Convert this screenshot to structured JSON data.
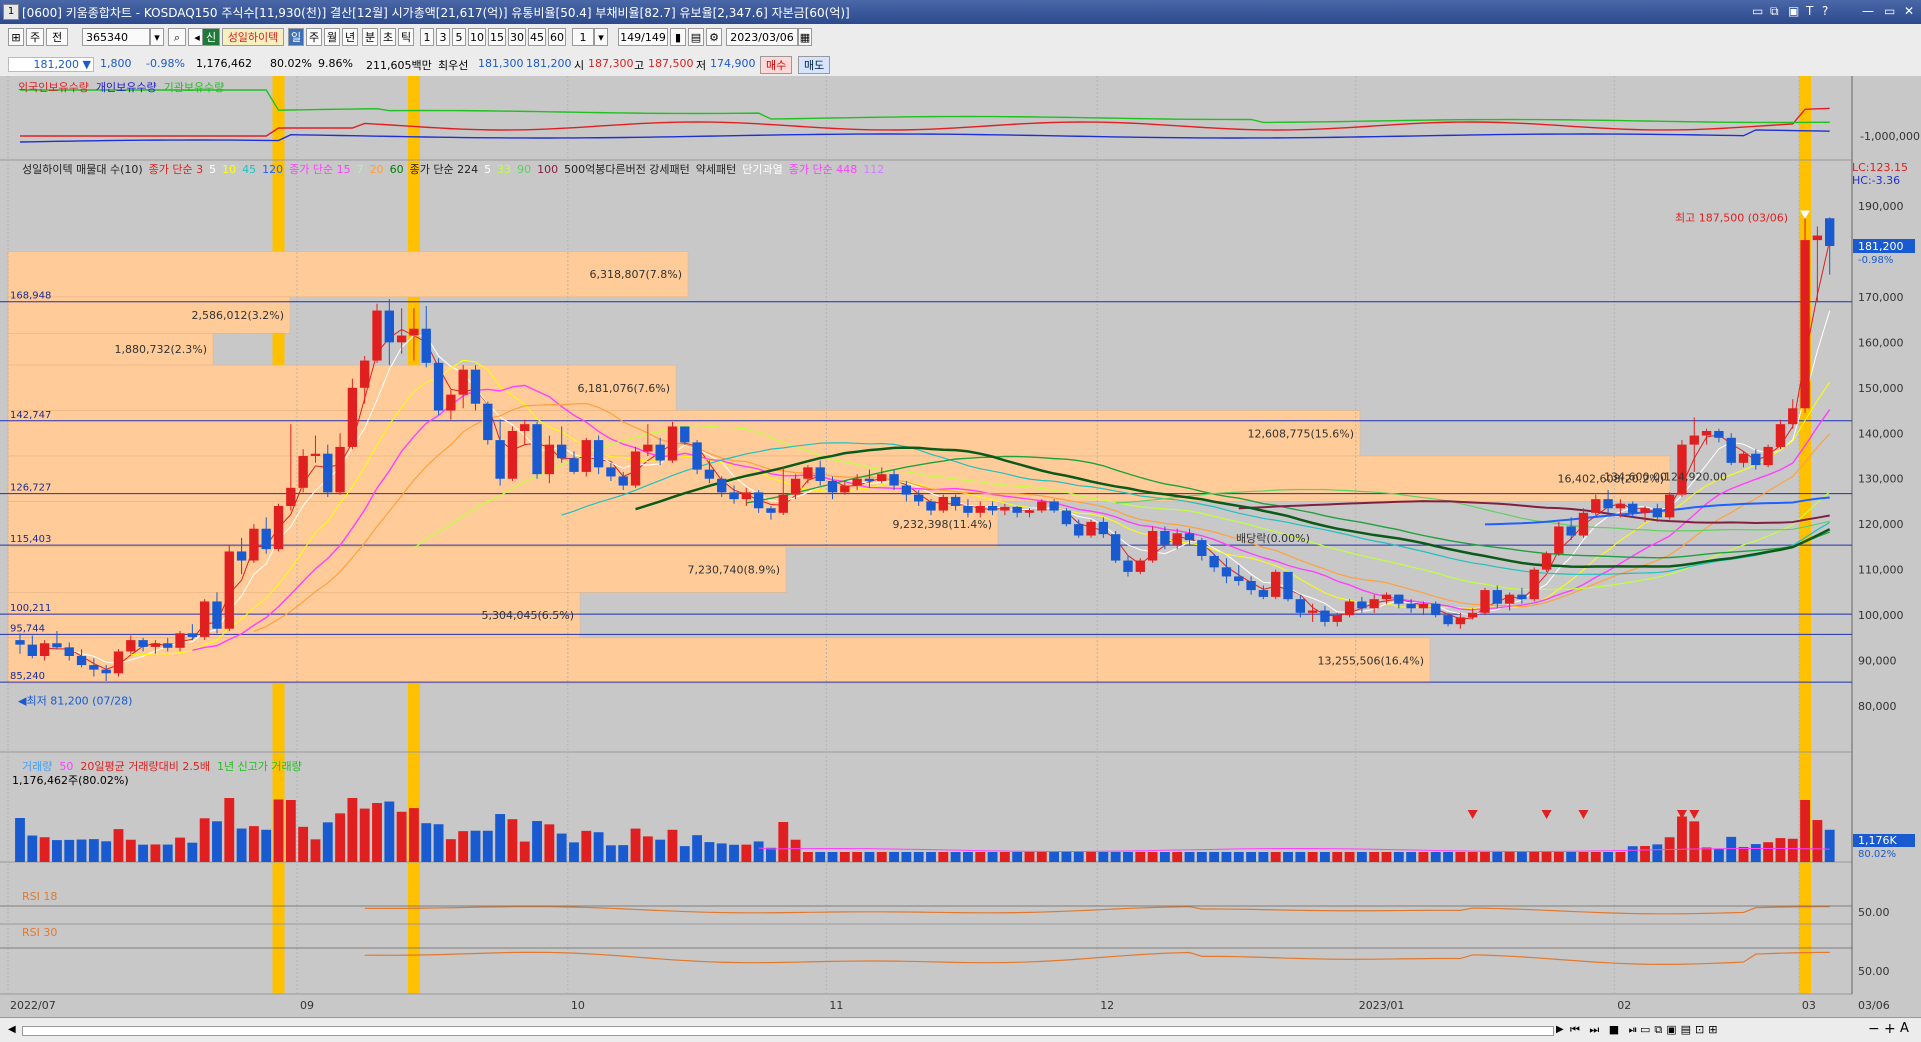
{
  "window": {
    "number": "1",
    "title": "[0600] 키움종합차트 - KOSDAQ150 주식수[11,930(천)] 결산[12월] 시가총액[21,617(억)] 유통비율[50.4] 부채비율[82.7] 유보율[2,347.6] 자본금[60(억)]",
    "controls": [
      "▭",
      "⧉",
      "▣",
      "T",
      "?",
      "—",
      "▭",
      "✕"
    ]
  },
  "toolbar": {
    "period_main": "주",
    "period_main2": "전",
    "code": "365340",
    "badge": "신",
    "stock_name": "성일하이텍",
    "intervals": [
      "일",
      "주",
      "월",
      "년",
      "분",
      "초",
      "틱"
    ],
    "active_interval": "일",
    "minutes": [
      "1",
      "3",
      "5",
      "10",
      "15",
      "30",
      "45",
      "60"
    ],
    "count": "1",
    "page": "149/149",
    "date": "2023/03/06"
  },
  "quote": {
    "price": "181,200",
    "arrow": "▼",
    "change": "1,800",
    "change_pct": "-0.98%",
    "volume": "1,176,462",
    "ratio": "80.02%",
    "pct2": "9.86%",
    "amount": "211,605백만",
    "bestbid_label": "최우선",
    "bestbid1": "181,300",
    "bestbid2": "181,200",
    "open_label": "시",
    "open": "187,300",
    "high_label": "고",
    "high": "187,500",
    "low_label": "저",
    "low": "174,900",
    "buy": "매수",
    "sell": "매도"
  },
  "legends": {
    "top": [
      "외국인보유수량",
      "개인보유수량",
      "기관보유수량"
    ],
    "top_colors": [
      "#e02020",
      "#2020d0",
      "#20c020"
    ],
    "price": [
      {
        "t": "성일하이텍 매물대 수(10)",
        "c": "#222222"
      },
      {
        "t": "종가 단순 3",
        "c": "#e02020"
      },
      {
        "t": "5",
        "c": "#ffffff"
      },
      {
        "t": "10",
        "c": "#ffff00"
      },
      {
        "t": "45",
        "c": "#20c0c0"
      },
      {
        "t": "120",
        "c": "#2060ff"
      },
      {
        "t": "종가 단순 15",
        "c": "#ff40ff"
      },
      {
        "t": "7",
        "c": "#a0ffa0"
      },
      {
        "t": "20",
        "c": "#ffa040"
      },
      {
        "t": "60",
        "c": "#008000"
      },
      {
        "t": "종가 단순 224",
        "c": "#222222"
      },
      {
        "t": "5",
        "c": "#ffffff"
      },
      {
        "t": "33",
        "c": "#c0ff40"
      },
      {
        "t": "90",
        "c": "#60d060"
      },
      {
        "t": "100",
        "c": "#802040"
      },
      {
        "t": "500억봉다른버전 강세패턴",
        "c": "#222222"
      },
      {
        "t": "약세패턴",
        "c": "#222222"
      },
      {
        "t": "단기과열",
        "c": "#ffffff"
      },
      {
        "t": "종가 단순 448",
        "c": "#ff40ff"
      },
      {
        "t": "112",
        "c": "#d080ff"
      }
    ],
    "volume": [
      {
        "t": "거래량",
        "c": "#40a0ff"
      },
      {
        "t": "50",
        "c": "#ff40ff"
      },
      {
        "t": "20일평균 거래량대비 2.5배",
        "c": "#e02020"
      },
      {
        "t": "1년 신고가 거래량",
        "c": "#20c020"
      }
    ],
    "volume_value": "1,176,462주(80.02%)",
    "rsi1": "RSI 18",
    "rsi2": "RSI 30"
  },
  "right_axis": {
    "lc": "LC:123.15",
    "hc": "HC:-3.36",
    "holdings_tick": "-1,000,000",
    "price_ticks": [
      "190,000",
      "180,000",
      "170,000",
      "160,000",
      "150,000",
      "140,000",
      "130,000",
      "120,000",
      "110,000",
      "100,000",
      "90,000",
      "80,000"
    ],
    "current_price": "181,200",
    "current_pct": "-0.98%",
    "volume_tag": "1,176K",
    "volume_pct": "80.02%",
    "rsi_tick1": "50.00",
    "rsi_tick2": "50.00",
    "date_end": "03/06"
  },
  "price_levels": [
    "168,948",
    "142,747",
    "126,727",
    "115,403",
    "100,211",
    "95,744",
    "85,240"
  ],
  "volume_profile": [
    {
      "label": "6,318,807(7.8%)"
    },
    {
      "label": "2,586,012(3.2%)"
    },
    {
      "label": "1,880,732(2.3%)"
    },
    {
      "label": "6,181,076(7.6%)"
    },
    {
      "label": "12,608,775(15.6%)"
    },
    {
      "label": "16,402,608(20.2%)"
    },
    {
      "label": "9,232,398(11.4%)"
    },
    {
      "label": "7,230,740(8.9%)"
    },
    {
      "label": "5,304,045(6.5%)"
    },
    {
      "label": "13,255,506(16.4%)"
    }
  ],
  "annotations": {
    "high": "최고 187,500 (03/06)",
    "low": "최저 81,200 (07/28)",
    "dividend": "배당락(0.00%)",
    "level1": "134,600.00",
    "level2": "124,920.00"
  },
  "x_axis": [
    "2022/07",
    "09",
    "10",
    "11",
    "12",
    "2023/01",
    "02",
    "03"
  ],
  "colors": {
    "up": "#e02020",
    "down": "#1a5ad0",
    "panel": "#c8c8c8",
    "profile": "#ffcc99",
    "highlight": "#ffc000"
  },
  "chart_data": {
    "type": "candlestick",
    "ylim": [
      75000,
      195000
    ],
    "candles": [
      [
        94500,
        96000,
        91500,
        93500
      ],
      [
        93500,
        95500,
        90500,
        91000
      ],
      [
        91000,
        94500,
        90000,
        93800
      ],
      [
        93800,
        96500,
        92500,
        92900
      ],
      [
        92900,
        94000,
        90000,
        91000
      ],
      [
        91000,
        92500,
        88500,
        89000
      ],
      [
        89000,
        90500,
        86500,
        88000
      ],
      [
        88000,
        89000,
        85500,
        87200
      ],
      [
        87200,
        92500,
        86500,
        92000
      ],
      [
        92000,
        95500,
        91500,
        94500
      ],
      [
        94500,
        95000,
        92000,
        93000
      ],
      [
        93000,
        94500,
        91500,
        93800
      ],
      [
        93800,
        95000,
        92000,
        92800
      ],
      [
        92800,
        96500,
        92000,
        96000
      ],
      [
        96000,
        98000,
        94500,
        95200
      ],
      [
        95200,
        103500,
        94500,
        103000
      ],
      [
        103000,
        105000,
        96000,
        97000
      ],
      [
        97000,
        115500,
        96500,
        114000
      ],
      [
        114000,
        117000,
        109000,
        112000
      ],
      [
        112000,
        120000,
        111500,
        119000
      ],
      [
        119000,
        121500,
        113500,
        114500
      ],
      [
        114500,
        124500,
        114000,
        124000
      ],
      [
        124000,
        142000,
        123000,
        128000
      ],
      [
        128000,
        136500,
        127000,
        135000
      ],
      [
        135000,
        139500,
        133500,
        135500
      ],
      [
        135500,
        137500,
        126000,
        127000
      ],
      [
        127000,
        140000,
        126500,
        137000
      ],
      [
        137000,
        152000,
        136500,
        150000
      ],
      [
        150000,
        157000,
        146500,
        156000
      ],
      [
        156000,
        168500,
        155500,
        167000
      ],
      [
        167000,
        169500,
        155000,
        160000
      ],
      [
        160000,
        167500,
        157500,
        161500
      ],
      [
        161500,
        167500,
        156000,
        163000
      ],
      [
        163000,
        168000,
        154500,
        155500
      ],
      [
        155500,
        156500,
        144000,
        145000
      ],
      [
        145000,
        149500,
        143000,
        148500
      ],
      [
        148500,
        155000,
        145500,
        154000
      ],
      [
        154000,
        155000,
        145000,
        146500
      ],
      [
        146500,
        147000,
        137500,
        138500
      ],
      [
        138500,
        143000,
        128500,
        130000
      ],
      [
        130000,
        141500,
        129500,
        140500
      ],
      [
        140500,
        143000,
        137500,
        142000
      ],
      [
        142000,
        142500,
        130000,
        131000
      ],
      [
        131000,
        139500,
        129000,
        137500
      ],
      [
        137500,
        141500,
        133500,
        134500
      ],
      [
        134500,
        136000,
        131000,
        131500
      ],
      [
        131500,
        139000,
        130500,
        138500
      ],
      [
        138500,
        139500,
        131000,
        132500
      ],
      [
        132500,
        133500,
        129500,
        130500
      ],
      [
        130500,
        131500,
        127500,
        128500
      ],
      [
        128500,
        137000,
        128000,
        136000
      ],
      [
        136000,
        142000,
        135000,
        137500
      ],
      [
        137500,
        139000,
        133000,
        134000
      ],
      [
        134000,
        142500,
        133500,
        141500
      ],
      [
        141500,
        141500,
        137500,
        138000
      ],
      [
        138000,
        138500,
        131000,
        132000
      ],
      [
        132000,
        134000,
        129000,
        130000
      ],
      [
        130000,
        130500,
        126000,
        127000
      ],
      [
        127000,
        128500,
        124500,
        125500
      ],
      [
        125500,
        128000,
        124000,
        127000
      ],
      [
        127000,
        127500,
        122500,
        123500
      ],
      [
        123500,
        124000,
        121000,
        122500
      ],
      [
        122500,
        132500,
        122000,
        126500
      ],
      [
        126500,
        131000,
        125500,
        130000
      ],
      [
        130000,
        133000,
        129000,
        132500
      ],
      [
        132500,
        134000,
        128500,
        129500
      ],
      [
        129500,
        130500,
        125500,
        127000
      ],
      [
        127000,
        129500,
        126500,
        128500
      ],
      [
        128500,
        131000,
        127500,
        130000
      ],
      [
        130000,
        132000,
        128000,
        129500
      ],
      [
        129500,
        132500,
        129000,
        131000
      ],
      [
        131000,
        132000,
        127500,
        128500
      ],
      [
        128500,
        129500,
        125000,
        126500
      ],
      [
        126500,
        127500,
        124000,
        125000
      ],
      [
        125000,
        125500,
        122000,
        123000
      ],
      [
        123000,
        126500,
        122500,
        126000
      ],
      [
        126000,
        126500,
        123000,
        124000
      ],
      [
        124000,
        125500,
        121500,
        122500
      ],
      [
        122500,
        125000,
        121500,
        124000
      ],
      [
        124000,
        125000,
        122000,
        123000
      ],
      [
        123000,
        124500,
        122000,
        123800
      ],
      [
        123800,
        124000,
        121500,
        122500
      ],
      [
        122500,
        123500,
        121500,
        123000
      ],
      [
        123000,
        125500,
        122500,
        125000
      ],
      [
        125000,
        125500,
        122500,
        123000
      ],
      [
        123000,
        123500,
        119500,
        120000
      ],
      [
        120000,
        121000,
        117000,
        117500
      ],
      [
        117500,
        121000,
        117000,
        120500
      ],
      [
        120500,
        121500,
        117000,
        117800
      ],
      [
        117800,
        118500,
        111500,
        112000
      ],
      [
        112000,
        113000,
        108500,
        109500
      ],
      [
        109500,
        112500,
        109000,
        112000
      ],
      [
        112000,
        119500,
        111500,
        118500
      ],
      [
        118500,
        119500,
        114500,
        115500
      ],
      [
        115500,
        119000,
        114500,
        118000
      ],
      [
        118000,
        119000,
        115500,
        116500
      ],
      [
        116500,
        117000,
        112000,
        113000
      ],
      [
        113000,
        113500,
        109500,
        110500
      ],
      [
        110500,
        112500,
        107000,
        108500
      ],
      [
        108500,
        111000,
        106500,
        107500
      ],
      [
        107500,
        108500,
        104500,
        105500
      ],
      [
        105500,
        106500,
        103500,
        104000
      ],
      [
        104000,
        110000,
        103500,
        109500
      ],
      [
        109500,
        109500,
        103000,
        103500
      ],
      [
        103500,
        104500,
        99500,
        100500
      ],
      [
        100500,
        102500,
        98500,
        101000
      ],
      [
        101000,
        102000,
        97500,
        98500
      ],
      [
        98500,
        100500,
        97500,
        100000
      ],
      [
        100000,
        103500,
        99500,
        103000
      ],
      [
        103000,
        104000,
        100500,
        101500
      ],
      [
        101500,
        104500,
        100500,
        103500
      ],
      [
        103500,
        105000,
        102500,
        104500
      ],
      [
        104500,
        104500,
        101500,
        102500
      ],
      [
        102500,
        103500,
        100500,
        101500
      ],
      [
        101500,
        103000,
        100000,
        102500
      ],
      [
        102500,
        103000,
        99500,
        100000
      ],
      [
        100000,
        100500,
        97500,
        98000
      ],
      [
        98000,
        100500,
        97000,
        99500
      ],
      [
        99500,
        101500,
        99000,
        100500
      ],
      [
        100500,
        106000,
        100000,
        105500
      ],
      [
        105500,
        106500,
        101500,
        102500
      ],
      [
        102500,
        105000,
        101000,
        104500
      ],
      [
        104500,
        106000,
        102500,
        103500
      ],
      [
        103500,
        110500,
        103000,
        110000
      ],
      [
        110000,
        114000,
        109500,
        113500
      ],
      [
        113500,
        120500,
        113000,
        119500
      ],
      [
        119500,
        121500,
        116500,
        117500
      ],
      [
        117500,
        123500,
        117000,
        122500
      ],
      [
        122500,
        126500,
        122000,
        125500
      ],
      [
        125500,
        127500,
        122500,
        123500
      ],
      [
        123500,
        125500,
        121500,
        124500
      ],
      [
        124500,
        125000,
        121500,
        122500
      ],
      [
        122500,
        124000,
        120500,
        123500
      ],
      [
        123500,
        124500,
        120500,
        121500
      ],
      [
        121500,
        127000,
        121000,
        126500
      ],
      [
        126500,
        138500,
        126000,
        137500
      ],
      [
        137500,
        143500,
        131500,
        139500
      ],
      [
        139500,
        141000,
        137500,
        140500
      ],
      [
        140500,
        141000,
        138000,
        139000
      ],
      [
        139000,
        140000,
        133000,
        133500
      ],
      [
        133500,
        136000,
        132500,
        135500
      ],
      [
        135500,
        136500,
        132000,
        133000
      ],
      [
        133000,
        137500,
        132500,
        137000
      ],
      [
        137000,
        143000,
        136500,
        142000
      ],
      [
        142000,
        147500,
        141000,
        145500
      ],
      [
        145500,
        188000,
        144500,
        182500
      ],
      [
        182500,
        185500,
        169000,
        183500
      ],
      [
        187300,
        187500,
        174900,
        181200
      ]
    ]
  }
}
